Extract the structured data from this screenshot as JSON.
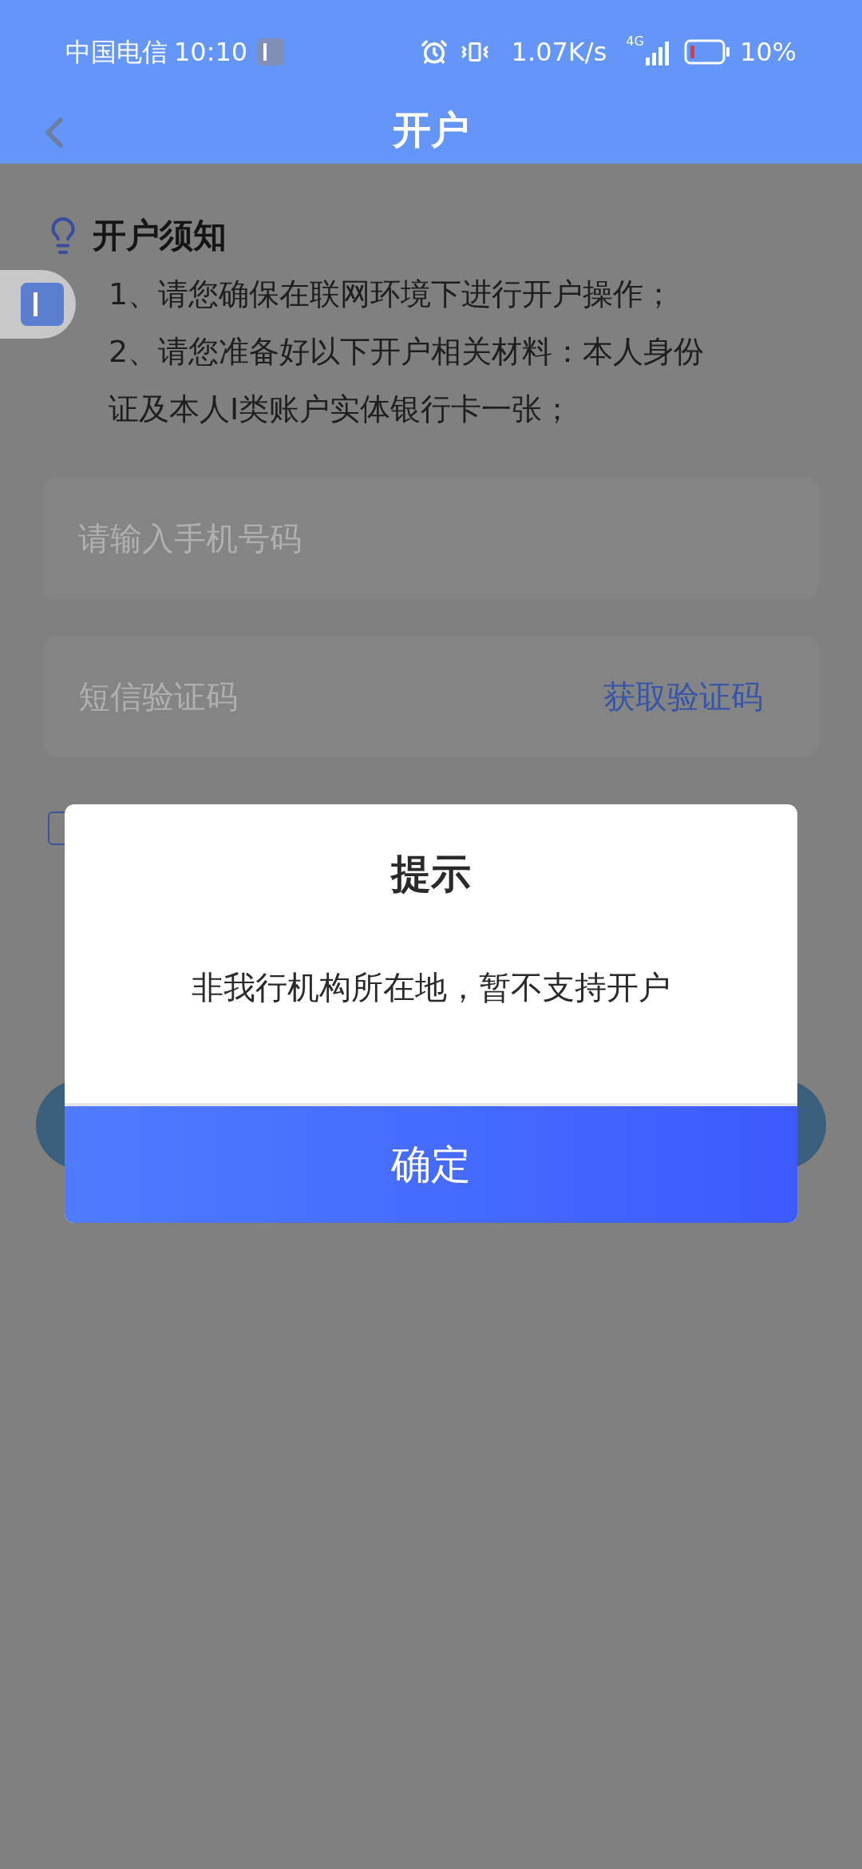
{
  "status_bar": {
    "carrier": "中国电信",
    "time": "10:10",
    "net_speed": "1.07K/s",
    "network": "4G",
    "battery": "10%"
  },
  "header": {
    "title": "开户"
  },
  "notice": {
    "title": "开户须知",
    "items": [
      "1、请您确保在联网环境下进行开户操作；",
      "2、请您准备好以下开户相关材料：本人身份证及本人I类账户实体银行卡一张；"
    ]
  },
  "form": {
    "phone": {
      "placeholder": "请输入手机号码"
    },
    "code": {
      "placeholder": "短信验证码",
      "action": "获取验证码"
    },
    "agreement": {
      "checked": false
    }
  },
  "dialog": {
    "title": "提示",
    "message": "非我行机构所在地，暂不支持开户",
    "button": "确定"
  }
}
